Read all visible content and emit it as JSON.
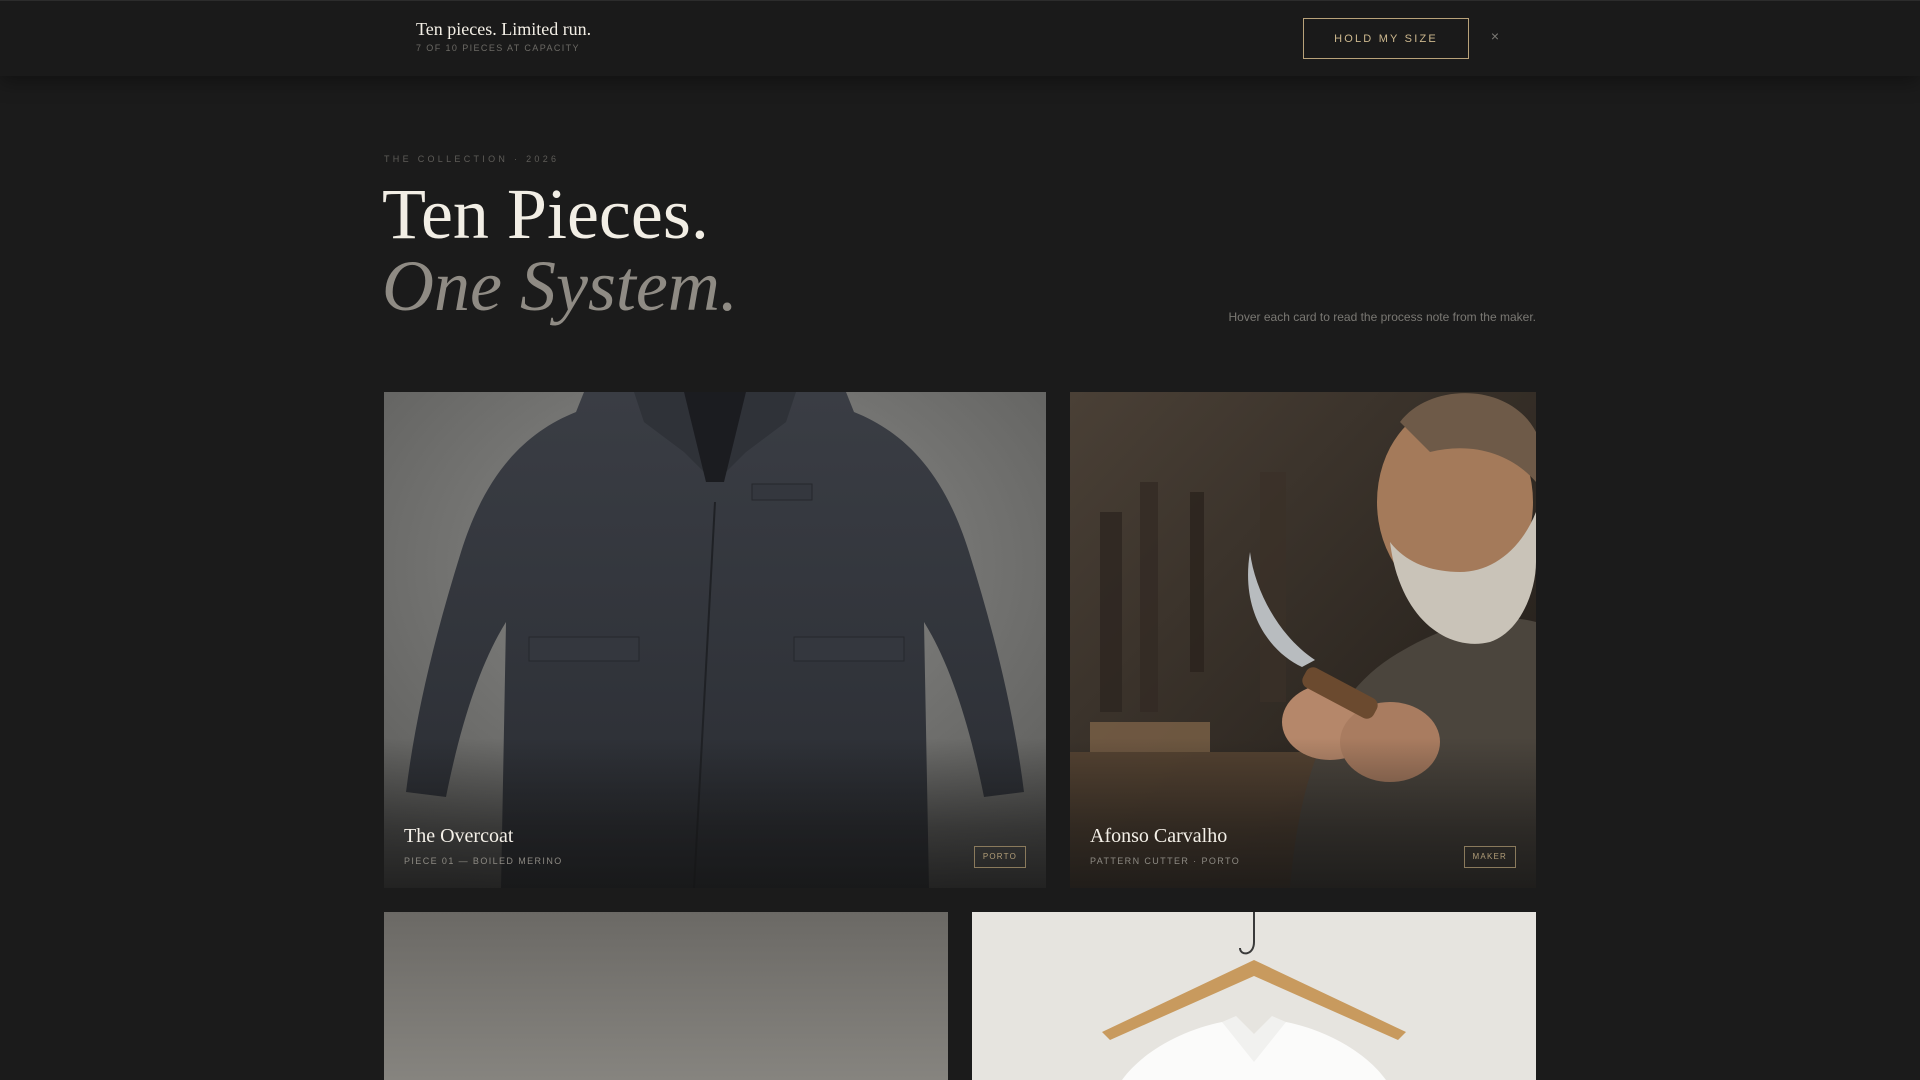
{
  "banner": {
    "title": "Ten pieces. Limited run.",
    "subtitle": "7 OF 10 PIECES AT CAPACITY",
    "cta_label": "HOLD MY SIZE",
    "close_glyph": "×",
    "close_icon": "close-icon"
  },
  "hero": {
    "eyebrow": "THE COLLECTION · 2026",
    "line1": "Ten Pieces.",
    "line2": "One System.",
    "hint": "Hover each card to read the process note from the maker."
  },
  "cards": [
    {
      "title": "The Overcoat",
      "subtitle": "PIECE 01 — BOILED MERINO",
      "tag": "PORTO",
      "image": "charcoal-overcoat-photo"
    },
    {
      "title": "Afonso Carvalho",
      "subtitle": "PATTERN CUTTER · PORTO",
      "tag": "MAKER",
      "image": "maker-portrait-photo"
    },
    {
      "image": "grey-backdrop-photo"
    },
    {
      "image": "white-shirt-on-hanger-photo"
    }
  ],
  "colors": {
    "background": "#1b1b1b",
    "accent": "#cdb88e",
    "text_primary": "#f2eee5",
    "text_muted": "#8f8b84"
  }
}
